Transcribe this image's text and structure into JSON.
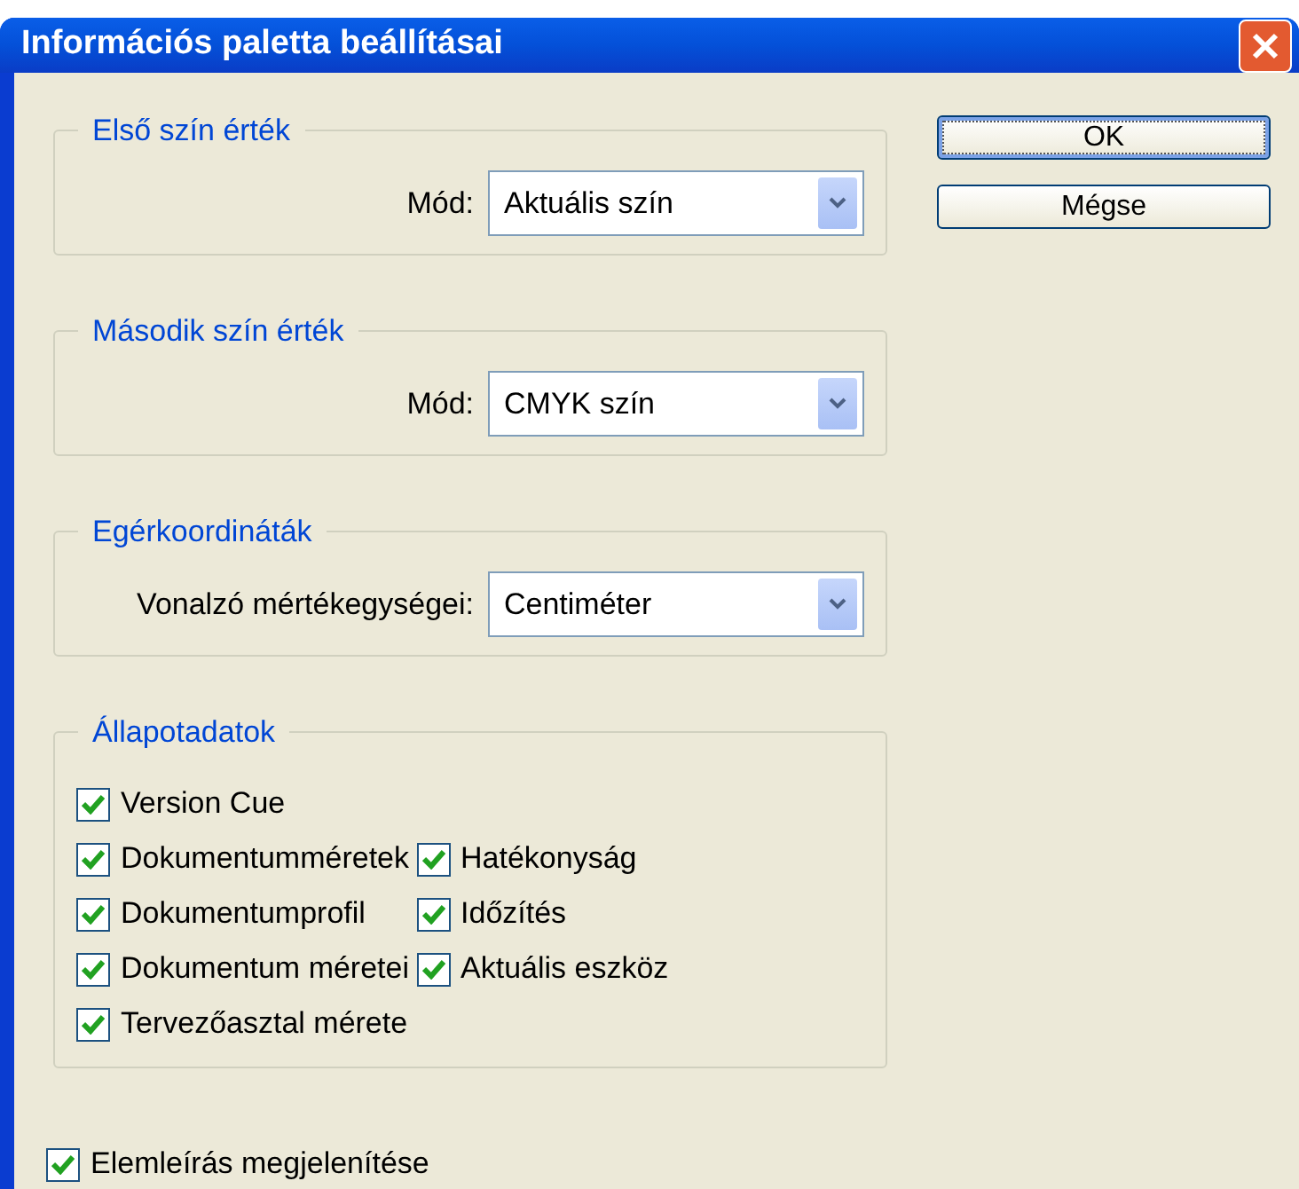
{
  "window": {
    "title": "Információs paletta beállításai"
  },
  "groups": [
    {
      "kind": "select",
      "title": "Első szín érték",
      "label": "Mód:",
      "value": "Aktuális szín"
    },
    {
      "kind": "select",
      "title": "Második szín érték",
      "label": "Mód:",
      "value": "CMYK szín"
    },
    {
      "kind": "select",
      "title": "Egérkoordináták",
      "label": "Vonalzó mértékegységei:",
      "value": "Centiméter"
    },
    {
      "kind": "checks",
      "title": "Állapotadatok",
      "columns": [
        [
          {
            "label": "Version Cue",
            "checked": true
          },
          {
            "label": "Dokumentumméretek",
            "checked": true
          },
          {
            "label": "Dokumentumprofil",
            "checked": true
          },
          {
            "label": "Dokumentum méretei",
            "checked": true
          },
          {
            "label": "Tervezőasztal mérete",
            "checked": true
          }
        ],
        [
          {
            "label": "Hatékonyság",
            "checked": true
          },
          {
            "label": "Időzítés",
            "checked": true
          },
          {
            "label": "Aktuális eszköz",
            "checked": true
          }
        ]
      ]
    }
  ],
  "buttons": [
    {
      "label": "OK",
      "default": true
    },
    {
      "label": "Mégse",
      "default": false
    }
  ],
  "footer_check": {
    "label": "Elemleírás megjelenítése",
    "checked": true
  }
}
